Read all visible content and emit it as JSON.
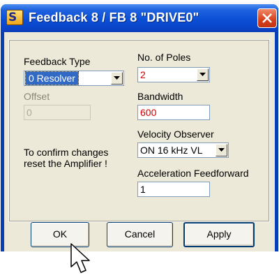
{
  "window": {
    "icon_letter": "S",
    "title": "Feedback  8 / FB 8 \"DRIVE0\""
  },
  "feedback_type": {
    "label": "Feedback Type",
    "selected": "0 Resolver"
  },
  "offset": {
    "label": "Offset",
    "value": "0"
  },
  "poles": {
    "label": "No. of Poles",
    "selected": "2"
  },
  "bandwidth": {
    "label": "Bandwidth",
    "value": "600"
  },
  "velocity_observer": {
    "label": "Velocity Observer",
    "selected": "ON  16 kHz VL"
  },
  "note": {
    "line1": "To confirm changes",
    "line2": "reset the Amplifier !"
  },
  "accel_ff": {
    "label": "Acceleration Feedforward",
    "value": "1"
  },
  "buttons": {
    "ok": "OK",
    "cancel": "Cancel",
    "apply": "Apply"
  },
  "colors": {
    "titlebar": "#0b4fd6",
    "changed_value": "#d00000",
    "dialog_face": "#ece9d8"
  }
}
